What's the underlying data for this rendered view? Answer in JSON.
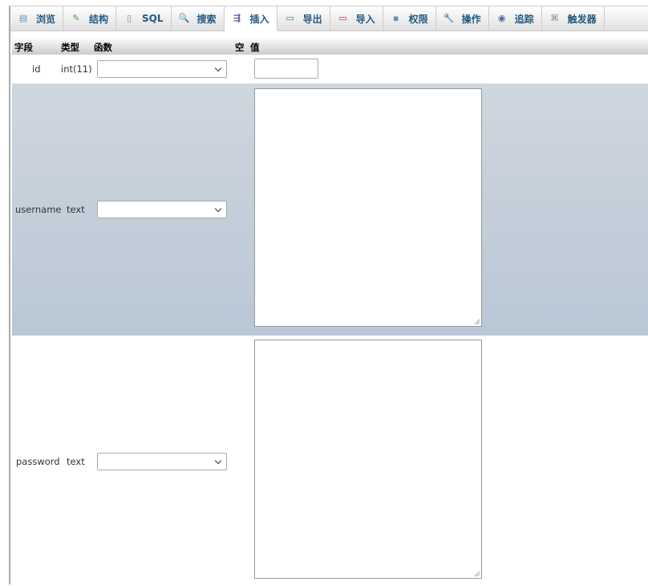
{
  "tabs": [
    {
      "label": "浏览",
      "icon": "browse-icon",
      "glyph": "▤",
      "color": "#6a8fb8"
    },
    {
      "label": "结构",
      "icon": "structure-icon",
      "glyph": "✎",
      "color": "#4a9a3a"
    },
    {
      "label": "SQL",
      "icon": "sql-icon",
      "glyph": "▯",
      "color": "#6a8fb8"
    },
    {
      "label": "搜索",
      "icon": "search-icon",
      "glyph": "🔍",
      "color": "#888"
    },
    {
      "label": "插入",
      "icon": "insert-icon",
      "glyph": "⇶",
      "color": "#6a4aa0",
      "active": true
    },
    {
      "label": "导出",
      "icon": "export-icon",
      "glyph": "▭",
      "color": "#3a8a3a"
    },
    {
      "label": "导入",
      "icon": "import-icon",
      "glyph": "▭",
      "color": "#c03030"
    },
    {
      "label": "权限",
      "icon": "privileges-icon",
      "glyph": "▪",
      "color": "#6a8fb8"
    },
    {
      "label": "操作",
      "icon": "wrench-icon",
      "glyph": "🔧",
      "color": "#6a8fb8"
    },
    {
      "label": "追踪",
      "icon": "eye-icon",
      "glyph": "◉",
      "color": "#4a6aa0"
    },
    {
      "label": "触发器",
      "icon": "trigger-icon",
      "glyph": "⌘",
      "color": "#999"
    }
  ],
  "header": {
    "field": "字段",
    "type": "类型",
    "function": "函数",
    "null": "空",
    "value": "值"
  },
  "rows": [
    {
      "field": "id",
      "type": "int(11)",
      "function": "",
      "value": ""
    },
    {
      "field": "username",
      "type": "text",
      "function": "",
      "value": ""
    },
    {
      "field": "password",
      "type": "text",
      "function": "",
      "value": ""
    }
  ]
}
